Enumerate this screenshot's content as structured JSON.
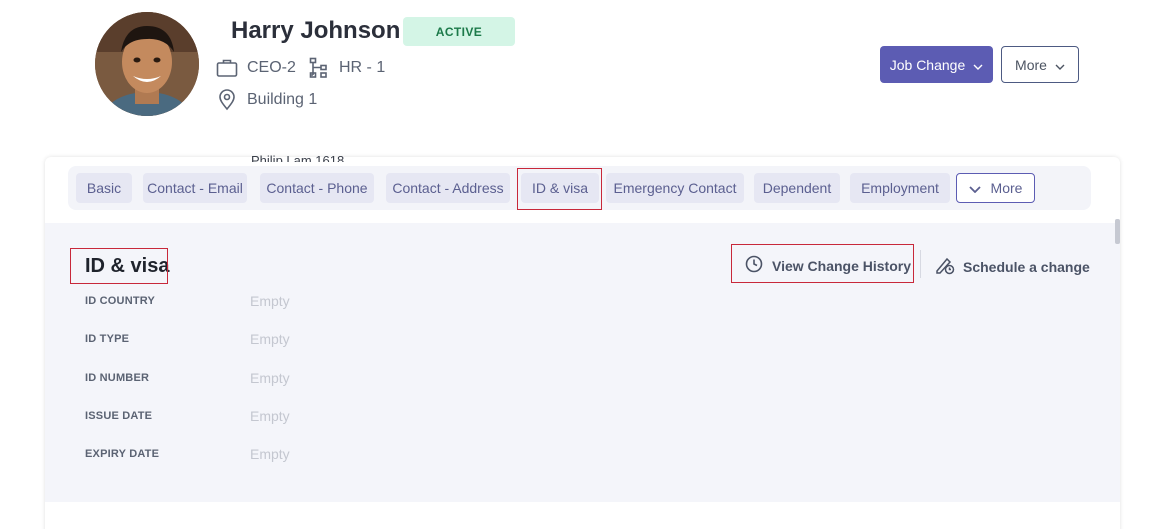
{
  "profile": {
    "name": "Harry Johnson",
    "status": "ACTIVE",
    "role": "CEO-2",
    "department": "HR - 1",
    "location": "Building 1"
  },
  "header_actions": {
    "job_change_label": "Job Change",
    "more_label": "More"
  },
  "clipped_text": "Philip Lam 1618",
  "tabs": [
    {
      "label": "Basic"
    },
    {
      "label": "Contact - Email"
    },
    {
      "label": "Contact - Phone"
    },
    {
      "label": "Contact - Address"
    },
    {
      "label": "ID & visa",
      "active": true
    },
    {
      "label": "Emergency Contact"
    },
    {
      "label": "Dependent"
    },
    {
      "label": "Employment"
    }
  ],
  "tabs_more_label": "More",
  "section": {
    "title": "ID & visa",
    "view_history_label": "View Change History",
    "schedule_label": "Schedule a change",
    "fields": [
      {
        "label": "ID COUNTRY",
        "value": "Empty"
      },
      {
        "label": "ID TYPE",
        "value": "Empty"
      },
      {
        "label": "ID NUMBER",
        "value": "Empty"
      },
      {
        "label": "ISSUE DATE",
        "value": "Empty"
      },
      {
        "label": "EXPIRY DATE",
        "value": "Empty"
      }
    ]
  },
  "colors": {
    "accent": "#5c5cb3",
    "status_bg": "#d4f5e6",
    "status_text": "#1c7a4a",
    "highlight": "#c8283a"
  },
  "icons": {
    "role": "briefcase-icon",
    "department": "org-chart-icon",
    "location": "map-pin-icon",
    "history": "clock-icon",
    "schedule": "pencil-clock-icon",
    "dropdown": "chevron-down-icon"
  }
}
